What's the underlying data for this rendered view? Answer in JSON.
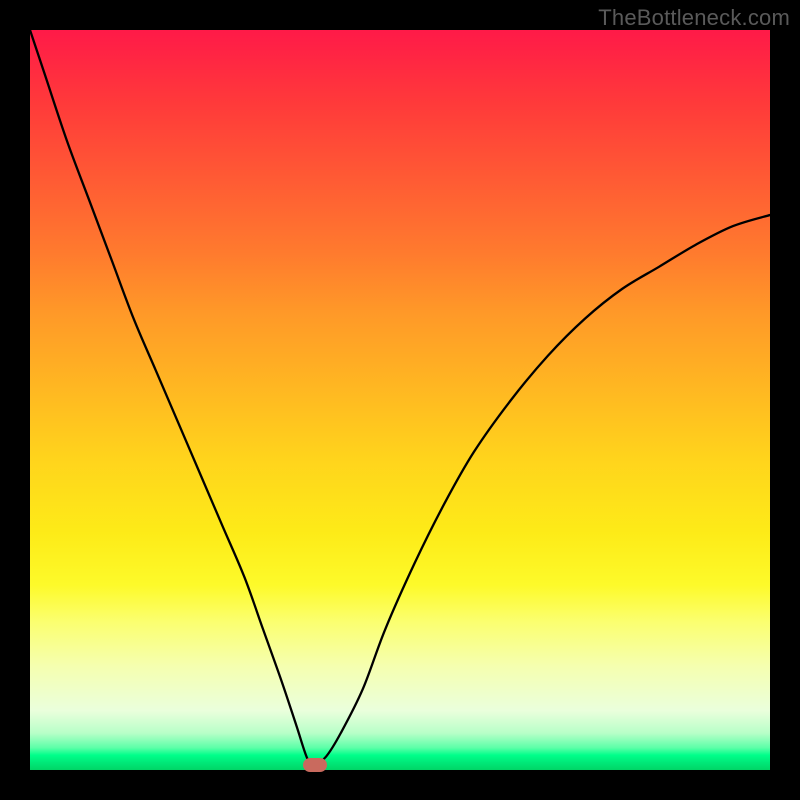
{
  "watermark": "TheBottleneck.com",
  "colors": {
    "frame": "#000000",
    "curve": "#000000",
    "marker": "#c96a5e"
  },
  "layout": {
    "outer": 800,
    "inner_left": 30,
    "inner_top": 30,
    "inner_size": 740
  },
  "marker": {
    "x_frac": 0.385,
    "y_frac": 0.993,
    "w": 24,
    "h": 14
  },
  "chart_data": {
    "type": "line",
    "title": "",
    "xlabel": "",
    "ylabel": "",
    "xlim": [
      0,
      100
    ],
    "ylim": [
      0,
      100
    ],
    "grid": false,
    "legend": false,
    "note": "V-shaped bottleneck curve; background encodes severity (red=high, green=optimal). Minimum near x≈38 at y≈0. x/y are percent of plot area; axes are unlabeled in source.",
    "series": [
      {
        "name": "bottleneck-curve",
        "x": [
          0,
          2,
          5,
          8,
          11,
          14,
          17,
          20,
          23,
          26,
          29,
          31.5,
          34,
          36,
          37.5,
          38.5,
          40,
          42,
          45,
          48,
          52,
          56,
          60,
          65,
          70,
          75,
          80,
          85,
          90,
          95,
          100
        ],
        "y": [
          100,
          94,
          85,
          77,
          69,
          61,
          54,
          47,
          40,
          33,
          26,
          19,
          12,
          6,
          1.5,
          0.8,
          1.8,
          5,
          11,
          19,
          28,
          36,
          43,
          50,
          56,
          61,
          65,
          68,
          71,
          73.5,
          75
        ]
      }
    ],
    "background_gradient": [
      {
        "pos": 0.0,
        "color": "#ff1a48"
      },
      {
        "pos": 0.1,
        "color": "#ff3a3a"
      },
      {
        "pos": 0.2,
        "color": "#ff5a34"
      },
      {
        "pos": 0.3,
        "color": "#ff7a2e"
      },
      {
        "pos": 0.38,
        "color": "#ff9828"
      },
      {
        "pos": 0.48,
        "color": "#ffb622"
      },
      {
        "pos": 0.58,
        "color": "#ffd41c"
      },
      {
        "pos": 0.68,
        "color": "#fdeb18"
      },
      {
        "pos": 0.75,
        "color": "#fdfa2a"
      },
      {
        "pos": 0.8,
        "color": "#fbff70"
      },
      {
        "pos": 0.86,
        "color": "#f5ffb0"
      },
      {
        "pos": 0.92,
        "color": "#eaffdc"
      },
      {
        "pos": 0.95,
        "color": "#b8ffc8"
      },
      {
        "pos": 0.97,
        "color": "#5cffa8"
      },
      {
        "pos": 0.98,
        "color": "#00ff8a"
      },
      {
        "pos": 0.99,
        "color": "#00e878"
      },
      {
        "pos": 1.0,
        "color": "#00d566"
      }
    ],
    "optimal_point": {
      "x": 38.5,
      "y": 0.7
    }
  }
}
